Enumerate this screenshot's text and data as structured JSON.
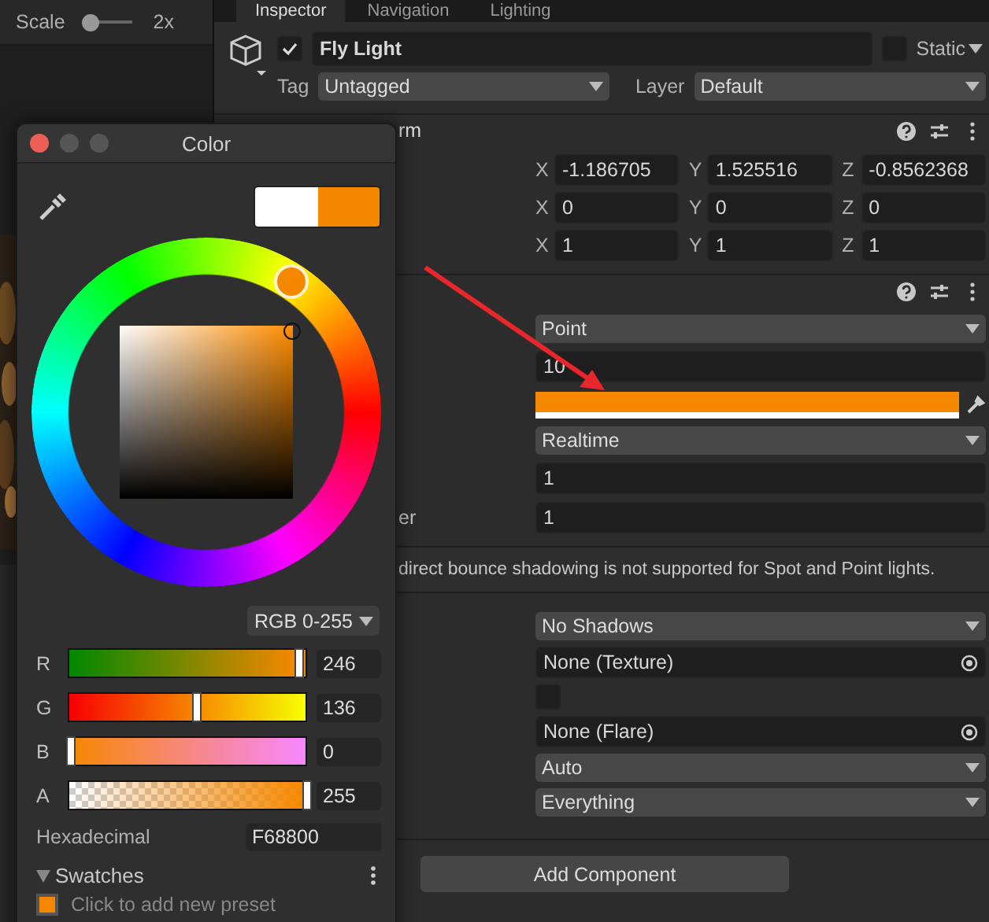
{
  "scene_toolbar": {
    "label": "Scale",
    "slider": {
      "level": 0.1
    },
    "value": "2x"
  },
  "tabs": [
    {
      "label": "Inspector",
      "selected": true
    },
    {
      "label": "Navigation",
      "selected": false
    },
    {
      "label": "Lighting",
      "selected": false
    }
  ],
  "object": {
    "enabled": true,
    "name": "Fly Light",
    "static": false,
    "static_label": "Static",
    "tag_label": "Tag",
    "tag": "Untagged",
    "layer_label": "Layer",
    "layer": "Default"
  },
  "transform": {
    "title": "rm",
    "rows": [
      [
        {
          "axis": "X",
          "value": "-1.186705"
        },
        {
          "axis": "Y",
          "value": "1.525516"
        },
        {
          "axis": "Z",
          "value": "-0.8562368"
        }
      ],
      [
        {
          "axis": "X",
          "value": "0"
        },
        {
          "axis": "Y",
          "value": "0"
        },
        {
          "axis": "Z",
          "value": "0"
        }
      ],
      [
        {
          "axis": "X",
          "value": "1"
        },
        {
          "axis": "Y",
          "value": "1"
        },
        {
          "axis": "Z",
          "value": "1"
        }
      ]
    ]
  },
  "light": {
    "rows": [
      {
        "kind": "dropdown",
        "value": "Point"
      },
      {
        "kind": "text",
        "value": "10"
      },
      {
        "kind": "color",
        "color": "#f68800"
      },
      {
        "kind": "dropdown",
        "value": "Realtime"
      },
      {
        "kind": "text",
        "value": "1"
      },
      {
        "kind": "text",
        "label": "er",
        "value": "1"
      }
    ],
    "note": "direct bounce shadowing is not supported for Spot and Point lights.",
    "more_rows": [
      {
        "kind": "dropdown",
        "value": "No Shadows"
      },
      {
        "kind": "object",
        "value": "None (Texture)"
      },
      {
        "kind": "checkbox",
        "checked": false
      },
      {
        "kind": "object",
        "value": "None (Flare)"
      },
      {
        "kind": "dropdown",
        "value": "Auto"
      },
      {
        "kind": "dropdown",
        "value": "Everything"
      }
    ]
  },
  "add_component": "Add Component",
  "color_picker": {
    "title": "Color",
    "preview": [
      {
        "color": "#ffffff"
      },
      {
        "color": "#f68800"
      }
    ],
    "mode": "RGB 0-255",
    "channels": [
      {
        "name": "R",
        "level": 0.965,
        "value": "246"
      },
      {
        "name": "G",
        "level": 0.533,
        "value": "136"
      },
      {
        "name": "B",
        "level": 0,
        "value": "0"
      },
      {
        "name": "A",
        "level": 1,
        "value": "255"
      }
    ],
    "hex_label": "Hexadecimal",
    "hex": "F68800",
    "swatches": {
      "title": "Swatches",
      "expanded": true,
      "presets": [
        {
          "color": "#f68800"
        }
      ],
      "hint": "Click to add new preset"
    }
  }
}
